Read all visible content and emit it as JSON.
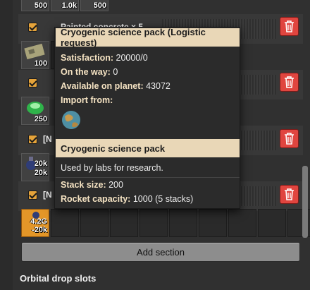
{
  "top_row": {
    "counts": [
      "500",
      "1.0k",
      "500"
    ]
  },
  "sections": [
    {
      "label": "Painted concrete × 5"
    },
    {
      "label": "[N"
    },
    {
      "label": "[N"
    },
    {
      "label": "[N"
    }
  ],
  "slots": {
    "concrete_count": "100",
    "green_count": "250",
    "cryo_count_a": "20k",
    "cryo_count_b": "20k",
    "orange_count_a": "4.2G",
    "orange_count_b": "-20k"
  },
  "add_section_label": "Add section",
  "orbital_label": "Orbital drop slots",
  "tooltip": {
    "title": "Cryogenic science pack (Logistic request)",
    "satisfaction_label": "Satisfaction:",
    "satisfaction_value": "20000/0",
    "on_the_way_label": "On the way:",
    "on_the_way_value": "0",
    "available_label": "Available on planet:",
    "available_value": "43072",
    "import_label": "Import from:",
    "item_title": "Cryogenic science pack",
    "description": "Used by labs for research.",
    "stack_label": "Stack size:",
    "stack_value": "200",
    "rocket_label": "Rocket capacity:",
    "rocket_value": "1000 (5 stacks)"
  },
  "colors": {
    "accent": "#e39628",
    "delete": "#e0453f",
    "tooltip_header": "#e9d7b7"
  },
  "icons": [
    "checkbox-icon",
    "trash-icon",
    "planet-icon",
    "cryogenic-science-pack-icon",
    "concrete-icon",
    "green-module-icon"
  ]
}
